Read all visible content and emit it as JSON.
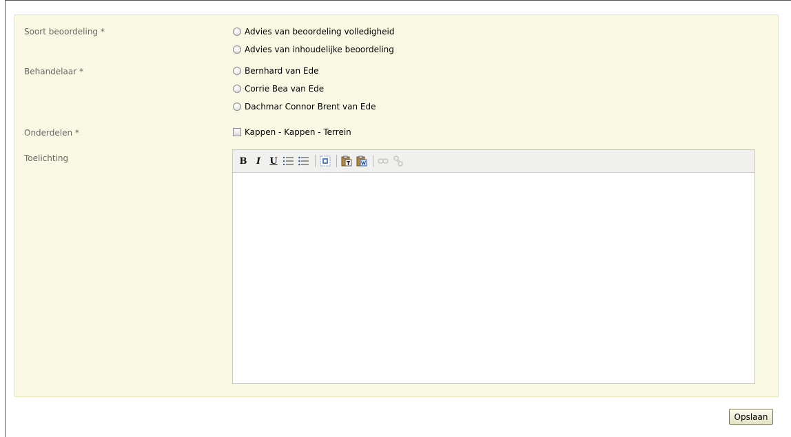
{
  "form": {
    "soort": {
      "label": "Soort beoordeling *",
      "options": [
        "Advies van beoordeling volledigheid",
        "Advies van inhoudelijke beoordeling"
      ]
    },
    "behandelaar": {
      "label": "Behandelaar *",
      "options": [
        "Bernhard van Ede",
        "Corrie Bea van Ede",
        "Dachmar Connor Brent van Ede"
      ]
    },
    "onderdelen": {
      "label": "Onderdelen *",
      "options": [
        "Kappen - Kappen - Terrein"
      ]
    },
    "toelichting": {
      "label": "Toelichting",
      "toolbar": {
        "bold": "B",
        "italic": "I",
        "underline": "U",
        "icons": [
          "bold-icon",
          "italic-icon",
          "underline-icon",
          "ordered-list-icon",
          "bullet-list-icon",
          "select-all-icon",
          "paste-text-icon",
          "paste-word-icon",
          "link-icon",
          "unlink-icon"
        ]
      }
    }
  },
  "buttons": {
    "save": "Opslaan"
  },
  "colors": {
    "panel_bg": "#f9f9e3",
    "panel_border": "#e9e9b8",
    "label_text": "#666666"
  }
}
